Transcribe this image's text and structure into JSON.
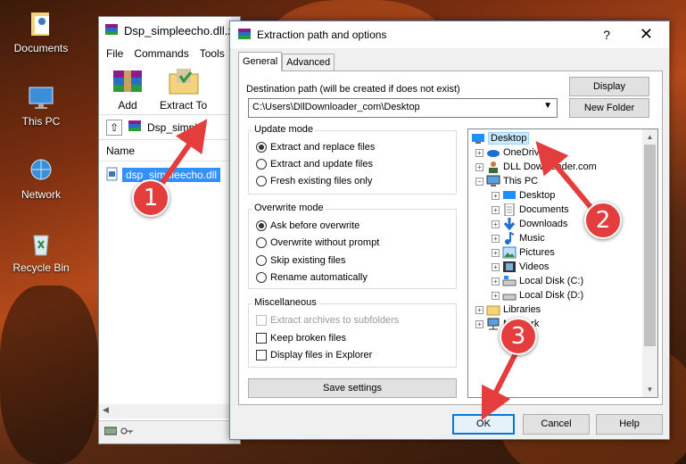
{
  "desktop": {
    "icons": [
      {
        "label": "Documents"
      },
      {
        "label": "This PC"
      },
      {
        "label": "Network"
      },
      {
        "label": "Recycle Bin"
      }
    ]
  },
  "winrar": {
    "title": "Dsp_simpleecho.dll.z",
    "menu": [
      "File",
      "Commands",
      "Tools"
    ],
    "toolbar": {
      "add": "Add",
      "extract_to": "Extract To"
    },
    "path": "Dsp_simple",
    "column_name": "Name",
    "file": "dsp_simpleecho.dll"
  },
  "dialog": {
    "title": "Extraction path and options",
    "help": "?",
    "close": "✕",
    "tabs": [
      "General",
      "Advanced"
    ],
    "destination_label": "Destination path (will be created if does not exist)",
    "destination_value": "C:\\Users\\DllDownloader_com\\Desktop",
    "display_button": "Display",
    "new_folder_button": "New Folder",
    "update_mode": {
      "title": "Update mode",
      "options": [
        "Extract and replace files",
        "Extract and update files",
        "Fresh existing files only"
      ],
      "selected": 0
    },
    "overwrite_mode": {
      "title": "Overwrite mode",
      "options": [
        "Ask before overwrite",
        "Overwrite without prompt",
        "Skip existing files",
        "Rename automatically"
      ],
      "selected": 0
    },
    "misc": {
      "title": "Miscellaneous",
      "options": [
        "Extract archives to subfolders",
        "Keep broken files",
        "Display files in Explorer"
      ]
    },
    "save_settings": "Save settings",
    "tree": {
      "desktop": "Desktop",
      "onedrive": "OneDrive",
      "dll": "DLL Downloader.com",
      "thispc": "This PC",
      "pc_children": [
        "Desktop",
        "Documents",
        "Downloads",
        "Music",
        "Pictures",
        "Videos",
        "Local Disk (C:)",
        "Local Disk (D:)"
      ],
      "libraries": "Libraries",
      "network": "Network"
    },
    "ok": "OK",
    "cancel": "Cancel",
    "help_button": "Help"
  },
  "markers": [
    "1",
    "2",
    "3"
  ],
  "colors": {
    "marker": "#e43d3d",
    "selection": "#3390ff",
    "accent": "#0078d7"
  }
}
